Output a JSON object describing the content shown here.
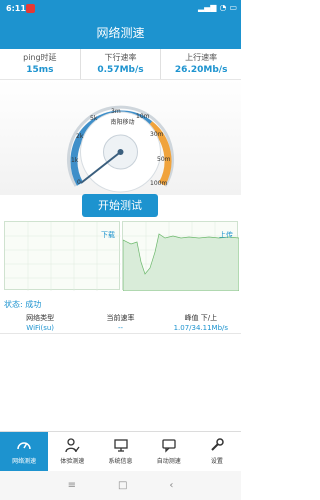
{
  "status_bar": {
    "time": "6:11"
  },
  "title": "网络测速",
  "stats": [
    {
      "label": "ping时延",
      "value": "15ms"
    },
    {
      "label": "下行速率",
      "value": "0.57Mb/s"
    },
    {
      "label": "上行速率",
      "value": "26.20Mb/s"
    }
  ],
  "gauge": {
    "center_label": "南阳移动",
    "ticks": [
      "0",
      "1k",
      "2k",
      "5k",
      "3m",
      "10m",
      "30m",
      "50m",
      "100m"
    ],
    "needle_level": 0.06
  },
  "start_button": "开始测试",
  "charts": {
    "download_label": "下载",
    "upload_label": "上传"
  },
  "status_line": "状态: 成功",
  "info": {
    "headers": [
      "网络类型",
      "当前速率",
      "峰值  下/上"
    ],
    "values": [
      "WiFi(su)",
      "--",
      "1.07/34.11Mb/s"
    ]
  },
  "nav": [
    {
      "label": "网络测速",
      "icon": "speedometer-icon"
    },
    {
      "label": "体验测速",
      "icon": "user-check-icon"
    },
    {
      "label": "系统信息",
      "icon": "monitor-icon"
    },
    {
      "label": "自动测速",
      "icon": "chat-icon"
    },
    {
      "label": "设置",
      "icon": "wrench-icon"
    }
  ],
  "colors": {
    "accent": "#1d93cf",
    "chart_fill": "#d9ecd9",
    "gauge_high": "#f0a33c"
  }
}
